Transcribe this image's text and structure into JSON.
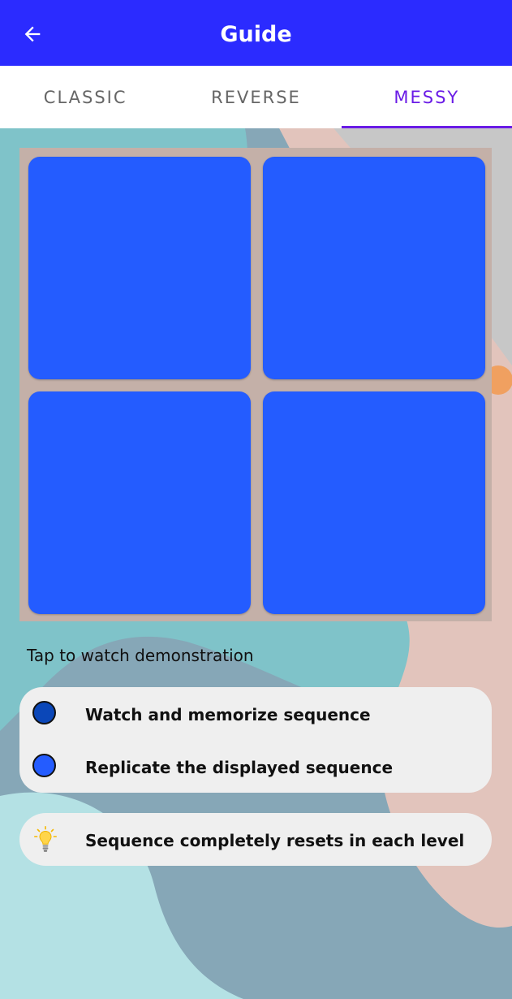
{
  "header": {
    "title": "Guide",
    "back_icon": "arrow-left-icon"
  },
  "tabs": [
    {
      "label": "CLASSIC",
      "active": false
    },
    {
      "label": "REVERSE",
      "active": false
    },
    {
      "label": "MESSY",
      "active": true
    }
  ],
  "board": {
    "tile_color": "#245cff",
    "background_color": "#c4b0a8"
  },
  "demo_hint": "Tap to watch demonstration",
  "legend": [
    {
      "color": "#0b47b8",
      "label": "Watch and memorize sequence"
    },
    {
      "color": "#245cff",
      "label": "Replicate the displayed sequence"
    }
  ],
  "tip": {
    "icon": "lightbulb-icon",
    "label": "Sequence completely resets in each level"
  },
  "colors": {
    "appbar": "#2b2bff",
    "accent": "#6a1be6"
  }
}
